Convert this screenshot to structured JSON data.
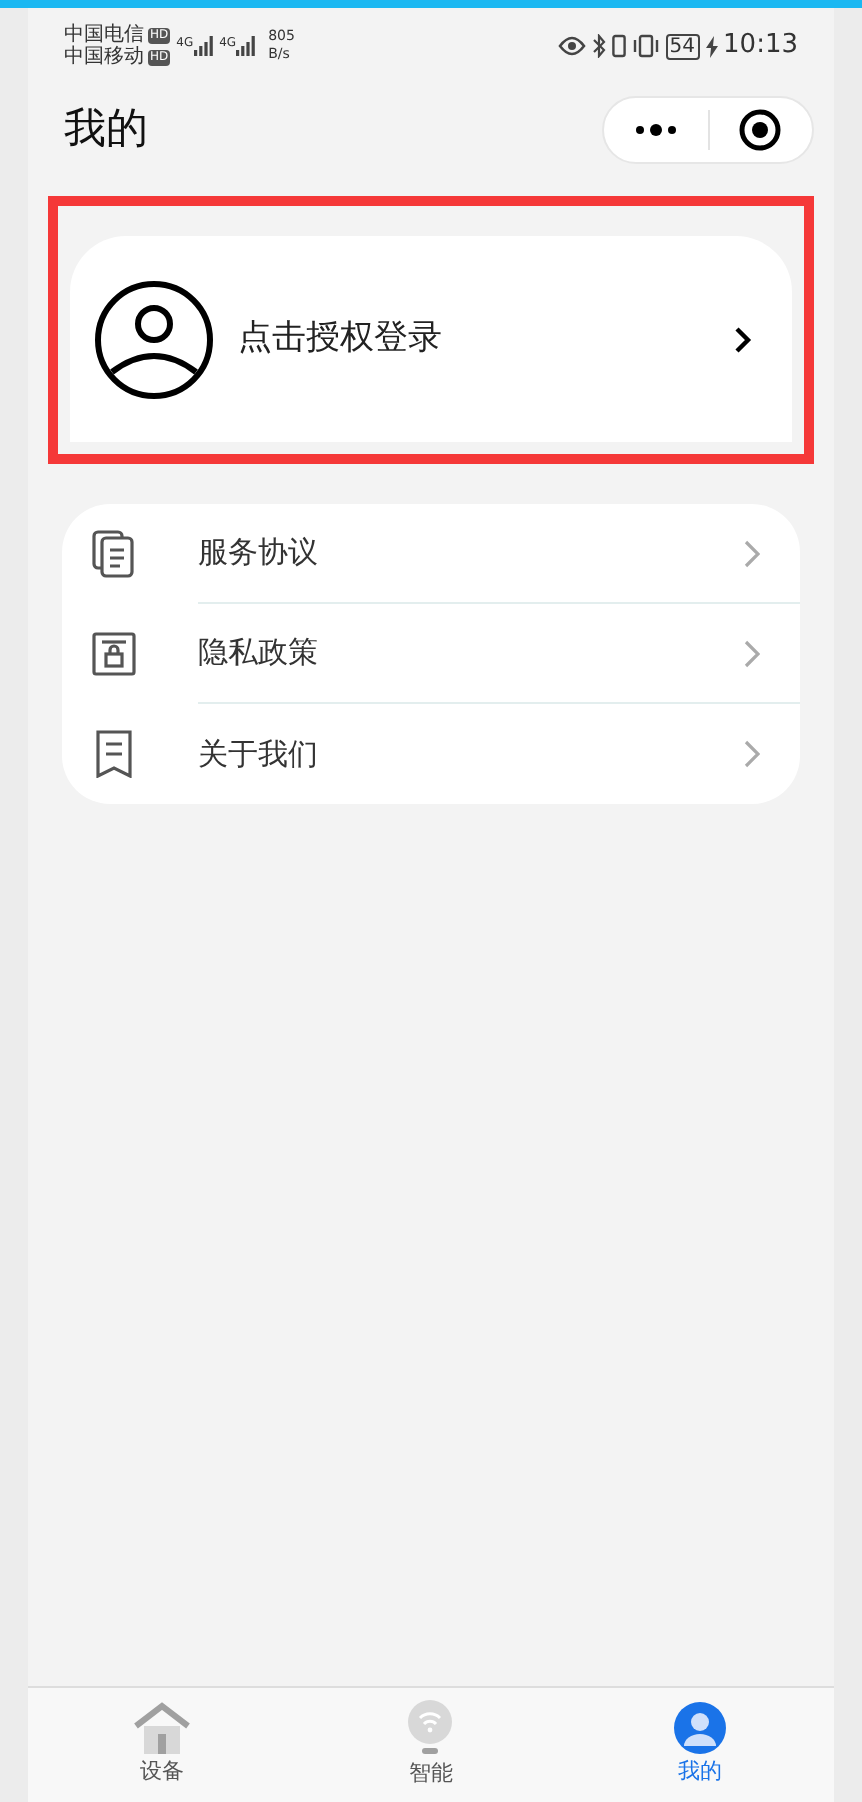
{
  "status_bar": {
    "carriers": [
      {
        "name": "中国电信",
        "badge": "HD"
      },
      {
        "name": "中国移动",
        "badge": "HD"
      }
    ],
    "network": [
      "4G",
      "4G"
    ],
    "speed": [
      "805",
      "B/s"
    ],
    "battery": "54",
    "time": "10:13"
  },
  "header": {
    "title": "我的"
  },
  "login": {
    "label": "点击授权登录",
    "highlighted": true
  },
  "menu": [
    {
      "kind": "docs",
      "label": "服务协议"
    },
    {
      "kind": "lock",
      "label": "隐私政策"
    },
    {
      "kind": "note",
      "label": "关于我们"
    }
  ],
  "tabs": [
    {
      "kind": "home",
      "label": "设备",
      "selected": false
    },
    {
      "kind": "bulb",
      "label": "智能",
      "selected": false
    },
    {
      "kind": "user",
      "label": "我的",
      "selected": true
    }
  ]
}
